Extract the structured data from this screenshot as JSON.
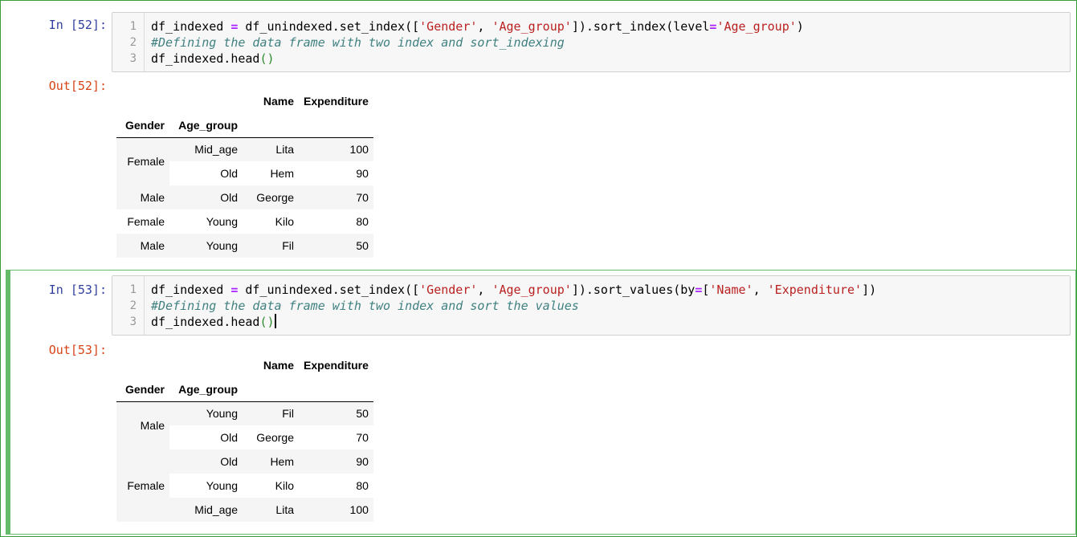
{
  "cells": [
    {
      "in_prompt": "In [52]:",
      "out_prompt": "Out[52]:",
      "line_numbers": [
        "1",
        "2",
        "3"
      ],
      "code": {
        "line1": [
          {
            "t": "df_indexed ",
            "c": ""
          },
          {
            "t": "=",
            "c": "op"
          },
          {
            "t": " df_unindexed.set_index([",
            "c": ""
          },
          {
            "t": "'Gender'",
            "c": "str"
          },
          {
            "t": ", ",
            "c": ""
          },
          {
            "t": "'Age_group'",
            "c": "str"
          },
          {
            "t": "]).sort_index(level",
            "c": ""
          },
          {
            "t": "=",
            "c": "op"
          },
          {
            "t": "'Age_group'",
            "c": "str"
          },
          {
            "t": ")",
            "c": ""
          }
        ],
        "line2": "#Defining the data frame with two index and sort_indexing",
        "line3_text": "df_indexed.head",
        "line3_parens": "()"
      },
      "table": {
        "columns": [
          "Name",
          "Expenditure"
        ],
        "index_names": [
          "Gender",
          "Age_group"
        ],
        "groups": [
          {
            "gender": "Female",
            "rows": [
              {
                "age": "Mid_age",
                "name": "Lita",
                "exp": "100"
              },
              {
                "age": "Old",
                "name": "Hem",
                "exp": "90"
              }
            ]
          },
          {
            "gender": "Male",
            "rows": [
              {
                "age": "Old",
                "name": "George",
                "exp": "70"
              }
            ]
          },
          {
            "gender": "Female",
            "rows": [
              {
                "age": "Young",
                "name": "Kilo",
                "exp": "80"
              }
            ]
          },
          {
            "gender": "Male",
            "rows": [
              {
                "age": "Young",
                "name": "Fil",
                "exp": "50"
              }
            ]
          }
        ]
      }
    },
    {
      "in_prompt": "In [53]:",
      "out_prompt": "Out[53]:",
      "line_numbers": [
        "1",
        "2",
        "3"
      ],
      "code": {
        "line1": [
          {
            "t": "df_indexed ",
            "c": ""
          },
          {
            "t": "=",
            "c": "op"
          },
          {
            "t": " df_unindexed.set_index([",
            "c": ""
          },
          {
            "t": "'Gender'",
            "c": "str"
          },
          {
            "t": ", ",
            "c": ""
          },
          {
            "t": "'Age_group'",
            "c": "str"
          },
          {
            "t": "]).sort_values(by",
            "c": ""
          },
          {
            "t": "=",
            "c": "op"
          },
          {
            "t": "[",
            "c": ""
          },
          {
            "t": "'Name'",
            "c": "str"
          },
          {
            "t": ", ",
            "c": ""
          },
          {
            "t": "'Expenditure'",
            "c": "str"
          },
          {
            "t": "])",
            "c": ""
          }
        ],
        "line2": "#Defining the data frame with two index and sort the values",
        "line3_text": "df_indexed.head",
        "line3_parens": "()"
      },
      "table": {
        "columns": [
          "Name",
          "Expenditure"
        ],
        "index_names": [
          "Gender",
          "Age_group"
        ],
        "groups": [
          {
            "gender": "Male",
            "rows": [
              {
                "age": "Young",
                "name": "Fil",
                "exp": "50"
              },
              {
                "age": "Old",
                "name": "George",
                "exp": "70"
              }
            ]
          },
          {
            "gender": "Female",
            "rows": [
              {
                "age": "Old",
                "name": "Hem",
                "exp": "90"
              },
              {
                "age": "Young",
                "name": "Kilo",
                "exp": "80"
              },
              {
                "age": "Mid_age",
                "name": "Lita",
                "exp": "100"
              }
            ]
          }
        ]
      }
    }
  ],
  "colors": {
    "selected_cell_border": "#66bb6a",
    "in_prompt": "#303f9f",
    "out_prompt": "#d84315",
    "string_token": "#ba2121",
    "operator_token": "#aa22ff",
    "comment_token": "#408080"
  }
}
